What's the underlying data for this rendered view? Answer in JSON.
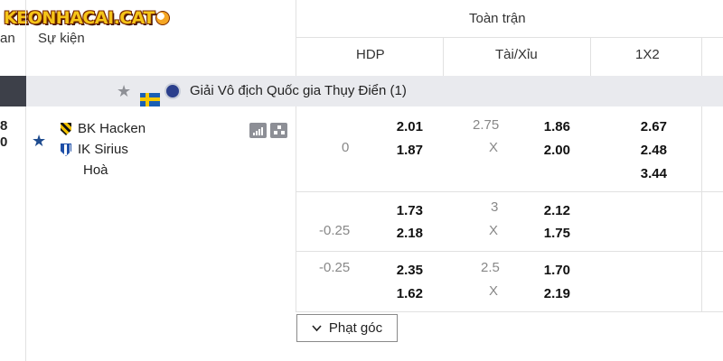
{
  "header": {
    "logo_text": "KEONHACAI.CAT",
    "col_time_partial": "an",
    "col_event": "Sự kiện",
    "fulltime": "Toàn trận",
    "sub_hdp": "HDP",
    "sub_ou": "Tài/Xỉu",
    "sub_1x2": "1X2"
  },
  "league": {
    "name": "Giải Vô địch Quốc gia Thụy Điển (1)",
    "star_icon": "star-icon",
    "flag_icon": "sweden-flag-icon",
    "logo_icon": "league-logo-icon"
  },
  "match": {
    "score_home_partial": "8",
    "score_away_partial": "0",
    "home": "BK Hacken",
    "away": "IK Sirius",
    "draw": "Hoà"
  },
  "markets": [
    {
      "hdp_line": "0",
      "hdp_home": "2.01",
      "hdp_away": "1.87",
      "ou_line": "2.75",
      "ou_x": "X",
      "ou_over": "1.86",
      "ou_under": "2.00",
      "x12_home": "2.67",
      "x12_away": "2.48",
      "x12_draw": "3.44"
    },
    {
      "hdp_line": "-0.25",
      "hdp_home": "1.73",
      "hdp_away": "2.18",
      "ou_line": "3",
      "ou_x": "X",
      "ou_over": "2.12",
      "ou_under": "1.75"
    },
    {
      "hdp_line": "-0.25",
      "hdp_home": "2.35",
      "hdp_away": "1.62",
      "ou_line": "2.5",
      "ou_x": "X",
      "ou_over": "1.70",
      "ou_under": "2.19"
    }
  ],
  "corner_button": "Phạt góc",
  "colors": {
    "league_bar": "#e9eaee",
    "accent_star": "#1f4c8f",
    "logo_yellow": "#f5c518"
  }
}
